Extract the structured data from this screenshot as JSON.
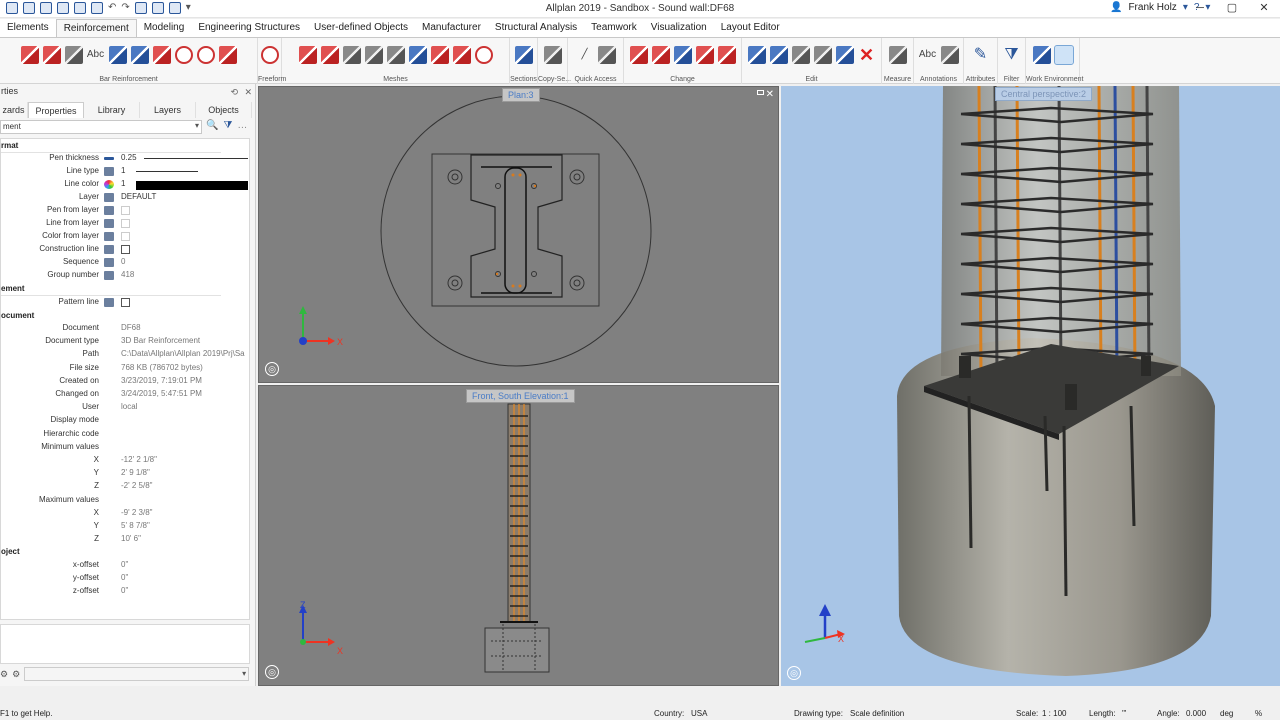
{
  "window": {
    "title": "Allplan 2019 - Sandbox - Sound wall:DF68",
    "user": "Frank Holz"
  },
  "ribbon": {
    "tabs": [
      "Elements",
      "Reinforcement",
      "Modeling",
      "Engineering Structures",
      "User-defined Objects",
      "Manufacturer",
      "Structural Analysis",
      "Teamwork",
      "Visualization",
      "Layout Editor"
    ],
    "groups": [
      "Bar Reinforcement",
      "Freeform",
      "Meshes",
      "Sections",
      "Copy-Se...",
      "Quick Access",
      "Change",
      "Edit",
      "Measure",
      "Annotations",
      "Attributes",
      "Filter",
      "Work Environment"
    ]
  },
  "panel": {
    "title": "rties",
    "tabs": [
      "zards",
      "Properties",
      "Library",
      "Layers",
      "Objects"
    ],
    "combo_value": "ment",
    "sections": {
      "format": "rmat",
      "element": "ement",
      "document": "ocument",
      "object": "oject"
    },
    "format_rows": [
      {
        "label": "Pen thickness",
        "value": "0.25"
      },
      {
        "label": "Line type",
        "value": "1"
      },
      {
        "label": "Line color",
        "value": "1"
      },
      {
        "label": "Layer",
        "value": "DEFAULT"
      },
      {
        "label": "Pen from layer",
        "value": ""
      },
      {
        "label": "Line from layer",
        "value": ""
      },
      {
        "label": "Color from layer",
        "value": ""
      },
      {
        "label": "Construction line",
        "value": ""
      },
      {
        "label": "Sequence",
        "value": "0"
      },
      {
        "label": "Group number",
        "value": "418"
      }
    ],
    "element_rows": [
      {
        "label": "Pattern line",
        "value": ""
      }
    ],
    "document_rows": [
      {
        "label": "Document",
        "value": "DF68"
      },
      {
        "label": "Document type",
        "value": "3D Bar Reinforcement"
      },
      {
        "label": "Path",
        "value": "C:\\Data\\Allplan\\Allplan 2019\\Prj\\Sa"
      },
      {
        "label": "File size",
        "value": "768 KB (786702 bytes)"
      },
      {
        "label": "Created on",
        "value": "3/23/2019, 7:19:01 PM"
      },
      {
        "label": "Changed on",
        "value": "3/24/2019, 5:47:51 PM"
      },
      {
        "label": "User",
        "value": "local"
      },
      {
        "label": "Display mode",
        "value": ""
      },
      {
        "label": "Hierarchic code",
        "value": ""
      },
      {
        "label": "Minimum values",
        "value": ""
      },
      {
        "label": "X",
        "value": "-12' 2 1/8\""
      },
      {
        "label": "Y",
        "value": "2' 9 1/8\""
      },
      {
        "label": "Z",
        "value": "-2' 2 5/8\""
      },
      {
        "label": "Maximum values",
        "value": ""
      },
      {
        "label": "X",
        "value": "-9' 2 3/8\""
      },
      {
        "label": "Y",
        "value": "5' 8 7/8\""
      },
      {
        "label": "Z",
        "value": "10' 6\""
      }
    ],
    "object_rows": [
      {
        "label": "x-offset",
        "value": "0\""
      },
      {
        "label": "y-offset",
        "value": "0\""
      },
      {
        "label": "z-offset",
        "value": "0\""
      }
    ]
  },
  "viewports": {
    "plan": {
      "label": "Plan:3"
    },
    "front": {
      "label": "Front, South Elevation:1"
    },
    "persp": {
      "label": "Central perspective:2"
    }
  },
  "axes": {
    "x": "X",
    "z": "Z"
  },
  "status": {
    "help": "F1 to get Help.",
    "country_label": "Country:",
    "country": "USA",
    "drawing_type_label": "Drawing type:",
    "drawing_type": "Scale definition",
    "scale_label": "Scale:",
    "scale": "1 : 100",
    "length_label": "Length:",
    "length": "'\"",
    "angle_label": "Angle:",
    "angle": "0.000",
    "angle_unit": "deg",
    "percent": "%"
  }
}
